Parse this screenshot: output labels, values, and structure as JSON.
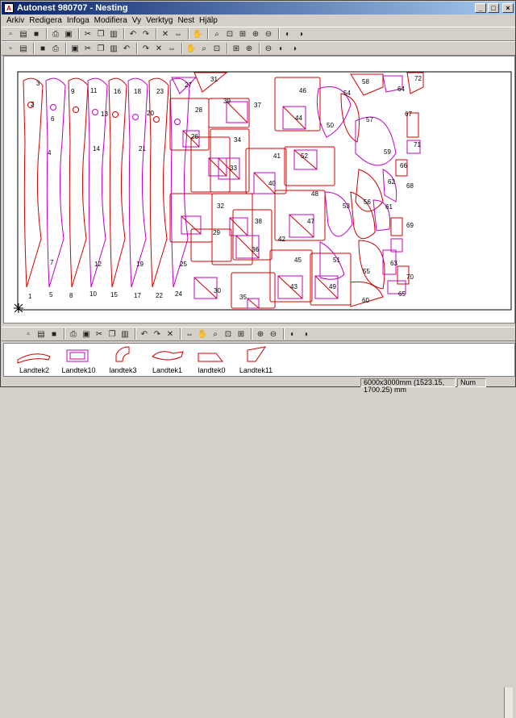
{
  "window": {
    "title": "Autonest  980707 - Nesting",
    "icon": "autonest-app-icon"
  },
  "menu": [
    "Arkiv",
    "Redigera",
    "Infoga",
    "Modifiera",
    "Vy",
    "Verktyg",
    "Nest",
    "Hjälp"
  ],
  "toolbar1_icons": [
    "new-icon",
    "open-icon",
    "save-icon",
    "print-icon",
    "print-preview-icon",
    "cut-icon",
    "copy-icon",
    "paste-icon",
    "undo-icon",
    "redo-icon",
    "delete-icon",
    "mirror-icon",
    "pan-icon",
    "zoom-icon",
    "zoom-window-icon",
    "zoom-all-icon",
    "zoom-in-icon",
    "zoom-out-icon",
    "zoom-previous-icon",
    "zoom-next-icon"
  ],
  "toolbar2_icons": [
    "select-icon",
    "settings-icon",
    "text-icon",
    "add-icon",
    "lasso-icon",
    "rectangle-icon",
    "line-icon",
    "arc-icon",
    "circle-icon",
    "move-icon",
    "rotate-icon",
    "copy-part-icon",
    "array-icon",
    "align-icon",
    "measure-icon",
    "snap-icon",
    "grid-icon",
    "nest-icon",
    "window-icon",
    "layers-icon"
  ],
  "bottom_toolbar_icons": [
    "parts-list-icon",
    "sheet-list-icon",
    "link-icon",
    "grid-view-icon",
    "number-icon",
    "sheet-icon",
    "fill-icon",
    "ruler-icon",
    "sort-icon",
    "scissors-icon",
    "remove-icon",
    "mirror-x-icon",
    "rotate-90-icon",
    "rotate-180-icon",
    "rotate-270-icon",
    "flip-icon",
    "cut-order-icon",
    "lead-in-icon",
    "lead-out-icon",
    "report-icon"
  ],
  "sheet_part_numbers": [
    "1",
    "2",
    "3",
    "4",
    "5",
    "6",
    "7",
    "8",
    "9",
    "10",
    "11",
    "12",
    "13",
    "14",
    "15",
    "16",
    "17",
    "18",
    "19",
    "20",
    "21",
    "22",
    "23",
    "24",
    "25",
    "26",
    "27",
    "28",
    "29",
    "30",
    "31",
    "32",
    "33",
    "34",
    "35",
    "36",
    "37",
    "38",
    "39",
    "40",
    "41",
    "42",
    "43",
    "44",
    "45",
    "46",
    "47",
    "48",
    "49",
    "50",
    "51",
    "52",
    "53",
    "54",
    "55",
    "56",
    "57",
    "58",
    "59",
    "60",
    "61",
    "62",
    "63",
    "64",
    "65",
    "66",
    "67",
    "68",
    "69",
    "70",
    "71",
    "72"
  ],
  "parts": [
    "Landtek2",
    "Landtek10",
    "landtek3",
    "Landtek1",
    "landtek0",
    "Landtek11"
  ],
  "status": {
    "dimensions": "6000x3000mm (1523.15, 1700.25) mm",
    "mode": "Num"
  },
  "colors": {
    "part_outline": "#d00000",
    "part_inner": "#c000c0",
    "title_start": "#0a246a",
    "title_end": "#a6caf0"
  }
}
